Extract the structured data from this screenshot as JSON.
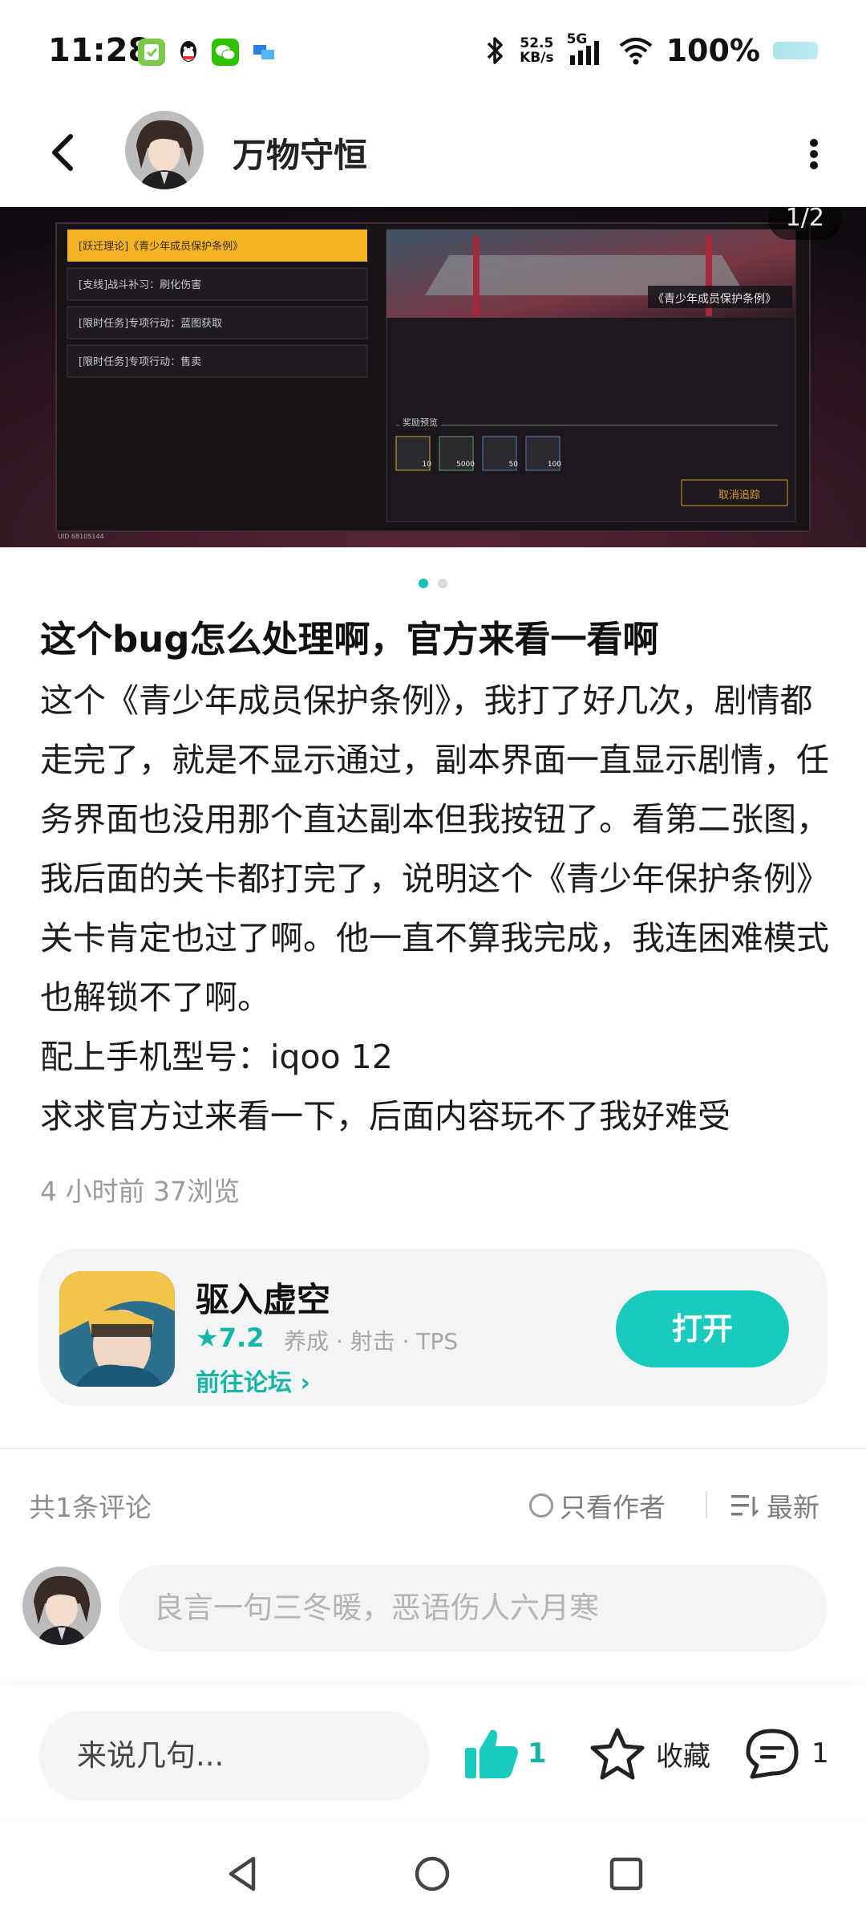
{
  "status_bar": {
    "time": "11:28",
    "net_speed_value": "52.5",
    "net_speed_unit": "KB/s",
    "network": "5G",
    "battery": "100%"
  },
  "header": {
    "username": "万物守恒"
  },
  "carousel": {
    "pager": "1/2",
    "screenshot": {
      "tasks": [
        "[跃迁理论]《青少年成员保护条例》",
        "[支线]战斗补习：刷化伤害",
        "[限时任务]专项行动：蓝图获取",
        "[限时任务]专项行动：售卖"
      ],
      "banner_title": "《青少年成员保护条例》",
      "reward_label": "奖励预览",
      "reward_counts": [
        "10",
        "5000",
        "50",
        "100"
      ],
      "cancel_label": "取消追踪",
      "uid": "UID 68105144"
    }
  },
  "post": {
    "title": "这个bug怎么处理啊，官方来看一看啊",
    "body": [
      "这个《青少年成员保护条例》，我打了好几次，剧情都走完了，就是不显示通过，副本界面一直显示剧情，任务界面也没用那个直达副本但我按钮了。看第二张图，我后面的关卡都打完了，说明这个《青少年保护条例》关卡肯定也过了啊。他一直不算我完成，我连困难模式也解锁不了啊。",
      "配上手机型号：iqoo  12",
      "求求官方过来看一下，后面内容玩不了我好难受"
    ],
    "meta": "4 小时前   37浏览"
  },
  "game_card": {
    "name": "驱入虚空",
    "rating": "7.2",
    "tags": "养成 · 射击 · TPS",
    "forum_link": "前往论坛",
    "open_button": "打开"
  },
  "comments": {
    "count_label": "共1条评论",
    "only_author": "只看作者",
    "sort": "最新",
    "input_placeholder": "良言一句三冬暖，恶语伤人六月寒"
  },
  "bottom_bar": {
    "input_placeholder": "来说几句...",
    "like_count": "1",
    "favorite_label": "收藏",
    "comment_count": "1"
  },
  "colors": {
    "accent": "#19cbbd",
    "accent_text": "#16b6a7",
    "muted": "#9a9a9a"
  }
}
